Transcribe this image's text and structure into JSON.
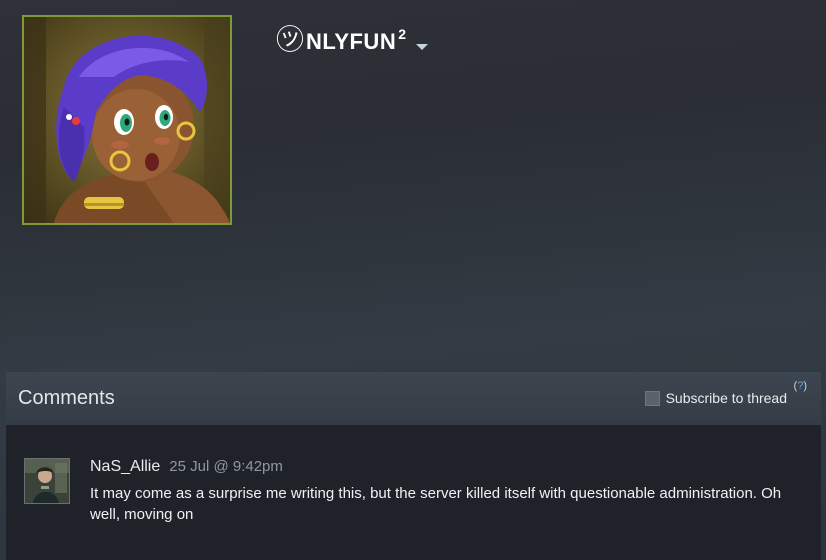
{
  "profile": {
    "name_glyph": "㋡",
    "name_main": "NLYFUN",
    "name_sup": "2",
    "avatar_icon": "anime-avatar-image",
    "avatar_border_color": "#7e9a3a"
  },
  "comments": {
    "title": "Comments",
    "subscribe_label": "Subscribe to thread",
    "help_open": "(",
    "help_q": "?",
    "help_close": ")",
    "items": [
      {
        "author": "NaS_Allie",
        "time": "25 Jul @ 9:42pm",
        "text": "It may come as a surprise me writing this, but the server killed itself with questionable administration. Oh well, moving on",
        "avatar_icon": "user-avatar-image"
      }
    ]
  },
  "colors": {
    "link_blue": "#66a2d6",
    "panel_bg": "#1f2329",
    "header_bg": "#3d4550"
  }
}
